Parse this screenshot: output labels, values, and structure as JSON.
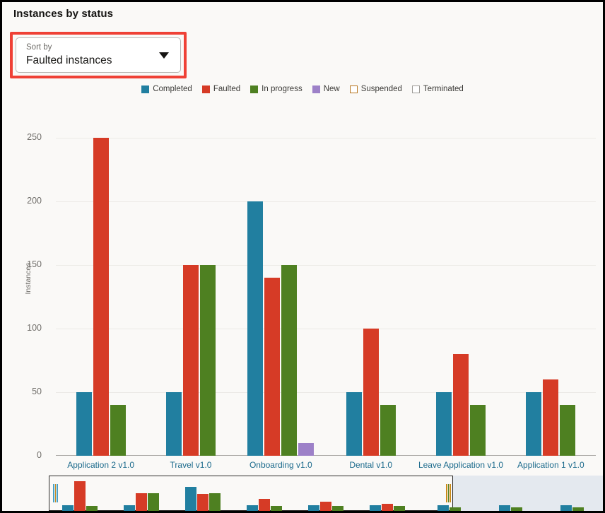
{
  "header": {
    "title": "Instances by status"
  },
  "sort": {
    "label": "Sort by",
    "value": "Faulted instances",
    "caret_icon": "chevron-down-icon"
  },
  "colors": {
    "completed": "#217fa0",
    "faulted": "#d63b26",
    "in_progress": "#4e8021",
    "new": "#9d81c8",
    "suspended_outline": "#b5731a",
    "terminated_outline": "#9b9995",
    "annotation": "#ef4136",
    "axis_text": "#6f6d69",
    "category_text": "#1b6a8c",
    "panel_bg": "#faf9f7",
    "range_inactive": "#e4e9ef"
  },
  "chart_data": {
    "type": "bar",
    "title": "Instances by status",
    "xlabel": "",
    "ylabel": "Instances",
    "ylim": [
      0,
      250
    ],
    "yticks": [
      0,
      50,
      100,
      150,
      200,
      250
    ],
    "grid": true,
    "legend_position": "top-center",
    "categories": [
      "Application 2 v1.0",
      "Travel v1.0",
      "Onboarding v1.0",
      "Dental v1.0",
      "Leave Application v1.0",
      "Application 1 v1.0"
    ],
    "series": [
      {
        "name": "Completed",
        "color": "#217fa0",
        "values": [
          50,
          50,
          200,
          50,
          50,
          50
        ]
      },
      {
        "name": "Faulted",
        "color": "#d63b26",
        "values": [
          250,
          150,
          140,
          100,
          80,
          60
        ]
      },
      {
        "name": "In progress",
        "color": "#4e8021",
        "values": [
          40,
          150,
          150,
          40,
          40,
          40
        ]
      },
      {
        "name": "New",
        "color": "#9d81c8",
        "values": [
          0,
          0,
          10,
          0,
          0,
          0
        ]
      },
      {
        "name": "Suspended",
        "color": "#ffffff",
        "values": [
          0,
          0,
          0,
          0,
          0,
          0
        ]
      },
      {
        "name": "Terminated",
        "color": "#ffffff",
        "values": [
          0,
          0,
          0,
          0,
          0,
          0
        ]
      }
    ]
  },
  "legend": [
    {
      "label": "Completed",
      "swatch": "#217fa0",
      "style": "filled"
    },
    {
      "label": "Faulted",
      "swatch": "#d63b26",
      "style": "filled"
    },
    {
      "label": "In progress",
      "swatch": "#4e8021",
      "style": "filled"
    },
    {
      "label": "New",
      "swatch": "#9d81c8",
      "style": "filled"
    },
    {
      "label": "Suspended",
      "swatch": "#b5731a",
      "style": "outline"
    },
    {
      "label": "Terminated",
      "swatch": "#9b9995",
      "style": "outline"
    }
  ],
  "range_selector": {
    "name": "range-scrollbar",
    "window_start_pct": 0,
    "window_end_pct": 73,
    "mini_series": [
      {
        "name": "Completed",
        "color": "#217fa0",
        "values": [
          50,
          50,
          200,
          50,
          50,
          50,
          50,
          50,
          50
        ]
      },
      {
        "name": "Faulted",
        "color": "#d63b26",
        "values": [
          250,
          150,
          140,
          100,
          80,
          60,
          0,
          0,
          0
        ]
      },
      {
        "name": "In progress",
        "color": "#4e8021",
        "values": [
          40,
          150,
          150,
          40,
          40,
          40,
          30,
          30,
          30
        ]
      }
    ]
  }
}
